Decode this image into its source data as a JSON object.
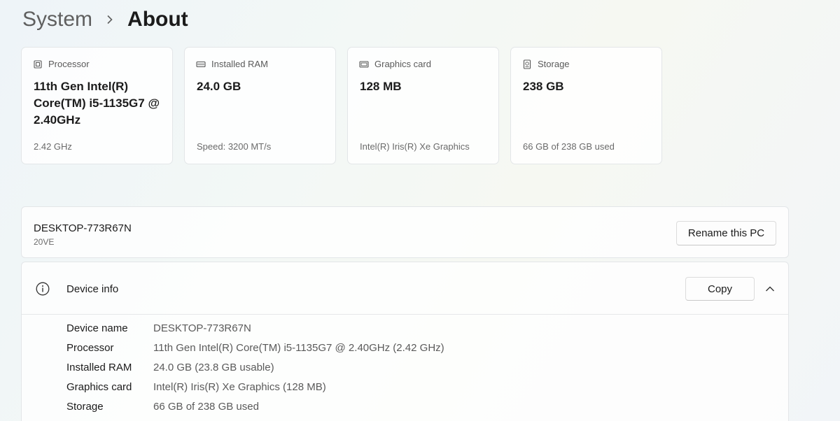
{
  "breadcrumb": {
    "parent": "System",
    "separator": "›",
    "current": "About"
  },
  "cards": [
    {
      "icon": "processor-icon",
      "label": "Processor",
      "value": "11th Gen Intel(R) Core(TM) i5-1135G7 @ 2.40GHz",
      "sub": "2.42 GHz"
    },
    {
      "icon": "ram-icon",
      "label": "Installed RAM",
      "value": "24.0 GB",
      "sub": "Speed: 3200 MT/s"
    },
    {
      "icon": "graphics-card-icon",
      "label": "Graphics card",
      "value": "128 MB",
      "sub": "Intel(R) Iris(R) Xe Graphics"
    },
    {
      "icon": "storage-icon",
      "label": "Storage",
      "value": "238 GB",
      "sub": "66 GB of 238 GB used"
    }
  ],
  "pc": {
    "name": "DESKTOP-773R67N",
    "model": "20VE",
    "rename_label": "Rename this PC"
  },
  "device_info": {
    "title": "Device info",
    "copy_label": "Copy",
    "specs": [
      {
        "label": "Device name",
        "value": "DESKTOP-773R67N"
      },
      {
        "label": "Processor",
        "value": "11th Gen Intel(R) Core(TM) i5-1135G7 @ 2.40GHz (2.42 GHz)"
      },
      {
        "label": "Installed RAM",
        "value": "24.0 GB (23.8 GB usable)"
      },
      {
        "label": "Graphics card",
        "value": "Intel(R) Iris(R) Xe Graphics (128 MB)"
      },
      {
        "label": "Storage",
        "value": "66 GB of 238 GB used"
      }
    ]
  }
}
